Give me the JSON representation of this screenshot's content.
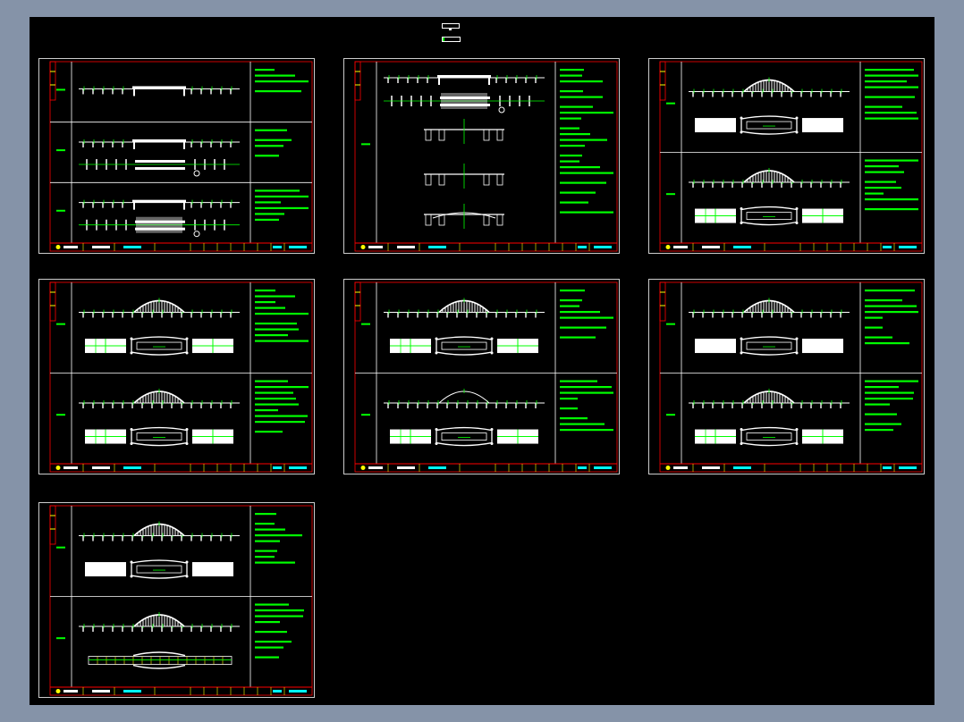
{
  "viewer": {
    "background": "#000000",
    "frame_color": "#8593a8",
    "sheet_count": 7
  },
  "colors": {
    "border": "#ffffff",
    "frame": "#ff0000",
    "annotation": "#00ff00",
    "highlight": "#00ffff",
    "title_mark": "#ffff00"
  },
  "sheets": [
    {
      "rows": [
        {
          "elev": "girder",
          "plan": "none"
        },
        {
          "elev": "girder",
          "plan": "girder"
        },
        {
          "elev": "girder",
          "plan": "girder-dense"
        }
      ]
    },
    {
      "rows": [
        {
          "elev": "sections",
          "plan": "none"
        }
      ]
    },
    {
      "rows": [
        {
          "elev": "arch",
          "plan": "arch-white"
        },
        {
          "elev": "arch",
          "plan": "arch-grid"
        }
      ]
    },
    {
      "rows": [
        {
          "elev": "arch",
          "plan": "arch-grid"
        },
        {
          "elev": "arch",
          "plan": "arch-grid"
        }
      ]
    },
    {
      "rows": [
        {
          "elev": "arch",
          "plan": "arch-grid"
        },
        {
          "elev": "arch-thin",
          "plan": "arch-grid"
        }
      ]
    },
    {
      "rows": [
        {
          "elev": "arch",
          "plan": "arch-white"
        },
        {
          "elev": "arch",
          "plan": "arch-grid"
        }
      ]
    },
    {
      "rows": [
        {
          "elev": "arch",
          "plan": "arch-white"
        },
        {
          "elev": "arch",
          "plan": "arch-deck"
        }
      ]
    }
  ]
}
